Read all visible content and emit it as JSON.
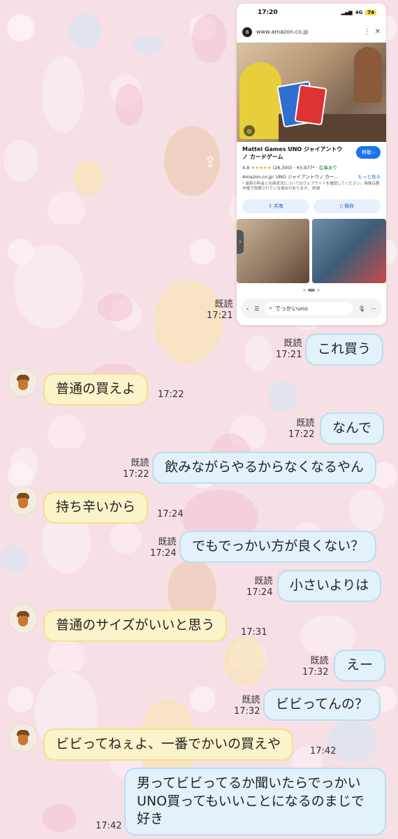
{
  "screenshot": {
    "status": {
      "time": "17:20",
      "network": "4G",
      "battery": "74"
    },
    "browser": {
      "url": "www.amazon.co.jp",
      "site_icon": "a"
    },
    "product": {
      "title": "Mattel Games UNO ジャイアントウノ カードゲーム",
      "rating": "4.8",
      "stars": "★★★★★",
      "reviews": "(26,300)",
      "price": "¥3,977*",
      "stock": "在庫あり",
      "description": "Amazon.co.jp: UNO ジャイアントウノ カー…",
      "more": "もっと見る",
      "note": "* 最新の料金と在庫状況についてはウェブサイトを確認してください。画像は著作権で保護されている場合があります。",
      "note_link": "詳細",
      "go_button": "移動",
      "share_button": "共有",
      "save_button": "保存"
    },
    "search_query": "でっかいuno"
  },
  "chat": {
    "messages": [
      {
        "side": "right",
        "text": "これ買う",
        "read": "既読",
        "time": "17:21"
      },
      {
        "side": "left",
        "text": "普通の買えよ",
        "time": "17:22"
      },
      {
        "side": "right",
        "text": "なんで",
        "read": "既読",
        "time": "17:22"
      },
      {
        "side": "right",
        "text": "飲みながらやるからなくなるやん",
        "read": "既読",
        "time": "17:22"
      },
      {
        "side": "left",
        "text": "持ち辛いから",
        "time": "17:24"
      },
      {
        "side": "right",
        "text": "でもでっかい方が良くない？",
        "read": "既読",
        "time": "17:24"
      },
      {
        "side": "right",
        "text": "小さいよりは",
        "read": "既読",
        "time": "17:24"
      },
      {
        "side": "left",
        "text": "普通のサイズがいいと思う",
        "time": "17:31"
      },
      {
        "side": "right",
        "text": "えー",
        "read": "既読",
        "time": "17:32"
      },
      {
        "side": "right",
        "text": "ビビってんの？",
        "read": "既読",
        "time": "17:32"
      },
      {
        "side": "left",
        "text": "ビビってねぇよ、一番でかいの買えや",
        "time": "17:42"
      },
      {
        "side": "right",
        "text": "男ってビビってるか聞いたらでっかいUNO買ってもいいことになるのまじで好き",
        "time": "17:42"
      }
    ],
    "screenshot_meta": {
      "read": "既読",
      "time": "17:21"
    }
  },
  "colors": {
    "background": "#f7dfe6",
    "right_bubble": "#e2f1fa",
    "left_bubble": "#fbf3c9",
    "go_button": "#1a73e8"
  }
}
